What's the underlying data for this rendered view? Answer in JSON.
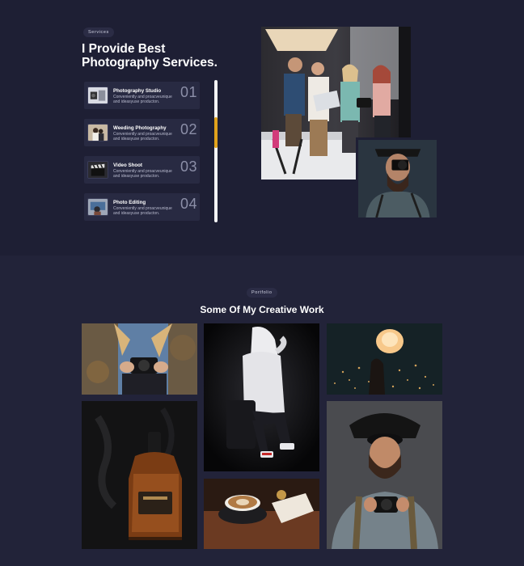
{
  "services": {
    "tag": "Services",
    "heading_line1": "I Provide Best",
    "heading_line2": "Photography Services.",
    "items": [
      {
        "title": "Photography Studio",
        "desc_line1": "Conveniently and proacveunique",
        "desc_line2": "and ideasyuse producton.",
        "num": "01",
        "thumb": "studio-icon"
      },
      {
        "title": "Weeding Photography",
        "desc_line1": "Conveniently and proacveunique",
        "desc_line2": "and ideasyuse producton.",
        "num": "02",
        "thumb": "wedding-icon"
      },
      {
        "title": "Video Shoot",
        "desc_line1": "Conveniently and proacveunique",
        "desc_line2": "and ideasyuse producton.",
        "num": "03",
        "thumb": "clapperboard-icon"
      },
      {
        "title": "Photo Editing",
        "desc_line1": "Conveniently and proacveunique",
        "desc_line2": "and ideasyuse producton.",
        "num": "04",
        "thumb": "editing-icon"
      }
    ],
    "progress": 0.25,
    "accent": "#e1a21c"
  },
  "portfolio": {
    "tag": "Portfolio",
    "heading": "Some Of My Creative Work"
  }
}
